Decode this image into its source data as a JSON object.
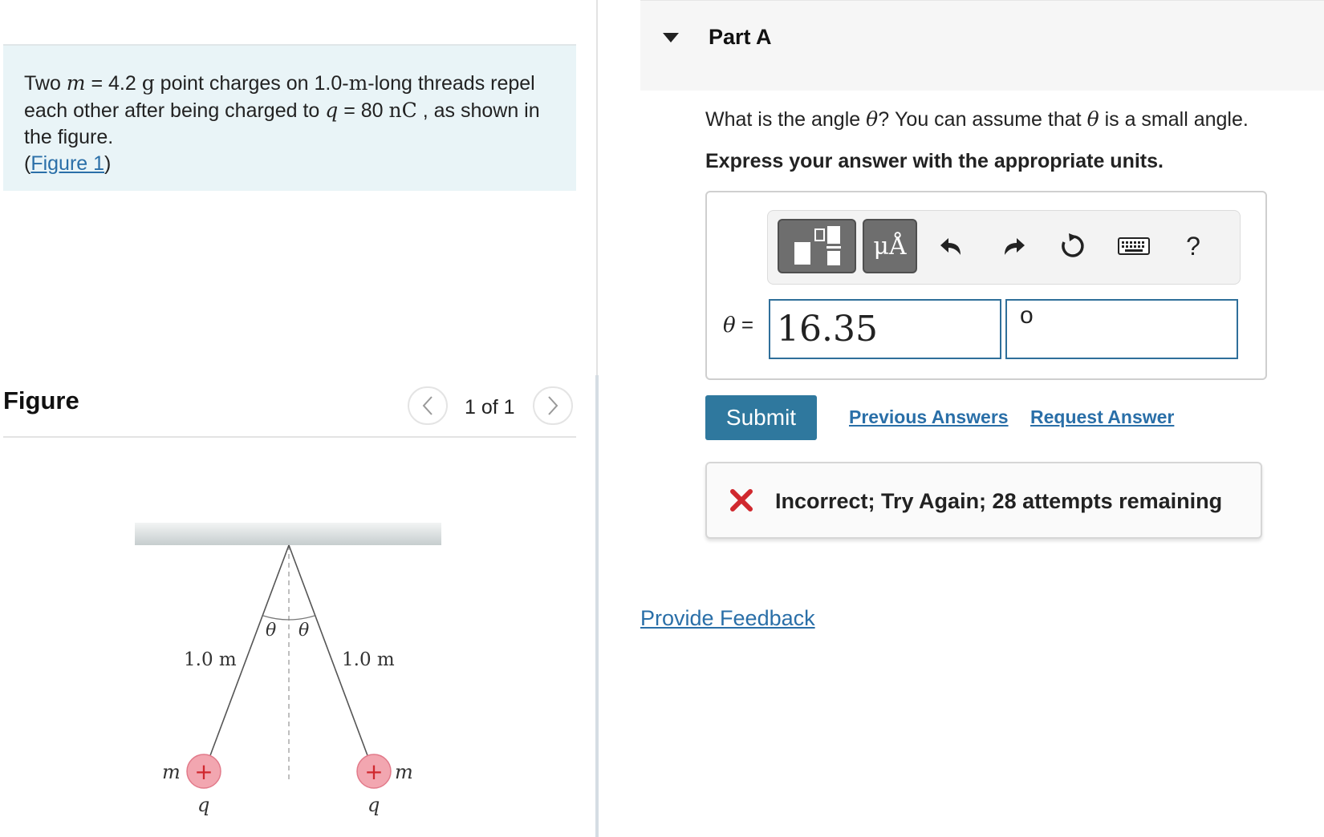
{
  "problem": {
    "p1": "Two ",
    "m_sym": "m",
    "p2": " = 4.2 ",
    "g_unit": "g",
    "p3": " point charges on 1.0-",
    "m_unit": "m",
    "p4": "-long threads repel each other after being charged to ",
    "q_sym": "q",
    "p5": " = 80 ",
    "nc_unit": "nC",
    "p6": " , as shown in the figure.",
    "fig_open": "(",
    "fig_link": "Figure 1",
    "fig_close": ")"
  },
  "figure": {
    "title": "Figure",
    "pager_text": "1 of 1",
    "labels": {
      "theta_left": "θ",
      "theta_right": "θ",
      "len_left": "1.0 m",
      "len_right": "1.0 m",
      "mass_left": "m",
      "mass_right": "m",
      "charge_left": "q",
      "charge_right": "q",
      "plus": "+"
    }
  },
  "part": {
    "title": "Part A",
    "question_pre": "What is the angle ",
    "question_theta": "θ",
    "question_mid": "? You can assume that ",
    "question_theta2": "θ",
    "question_post": " is a small angle.",
    "instruction": "Express your answer with the appropriate units."
  },
  "toolbar": {
    "units_label": "μÅ",
    "help_label": "?",
    "icons": [
      "fraction-template-icon",
      "units-icon",
      "undo-icon",
      "redo-icon",
      "reset-icon",
      "keyboard-icon",
      "help-icon"
    ]
  },
  "answer": {
    "theta_sym": "θ",
    "equals": " =",
    "value": "16.35",
    "unit": "o"
  },
  "actions": {
    "submit": "Submit",
    "previous_answers": "Previous Answers",
    "request_answer": "Request Answer"
  },
  "feedback": {
    "message": "Incorrect; Try Again; 28 attempts remaining",
    "color": "#d0282e"
  },
  "footer": {
    "provide_feedback": "Provide Feedback"
  },
  "colors": {
    "accent": "#2f789e",
    "link": "#2a6fa8",
    "problem_bg": "#e9f4f7",
    "input_border": "#2f6f9a",
    "charge_fill": "#f2a6b0"
  }
}
